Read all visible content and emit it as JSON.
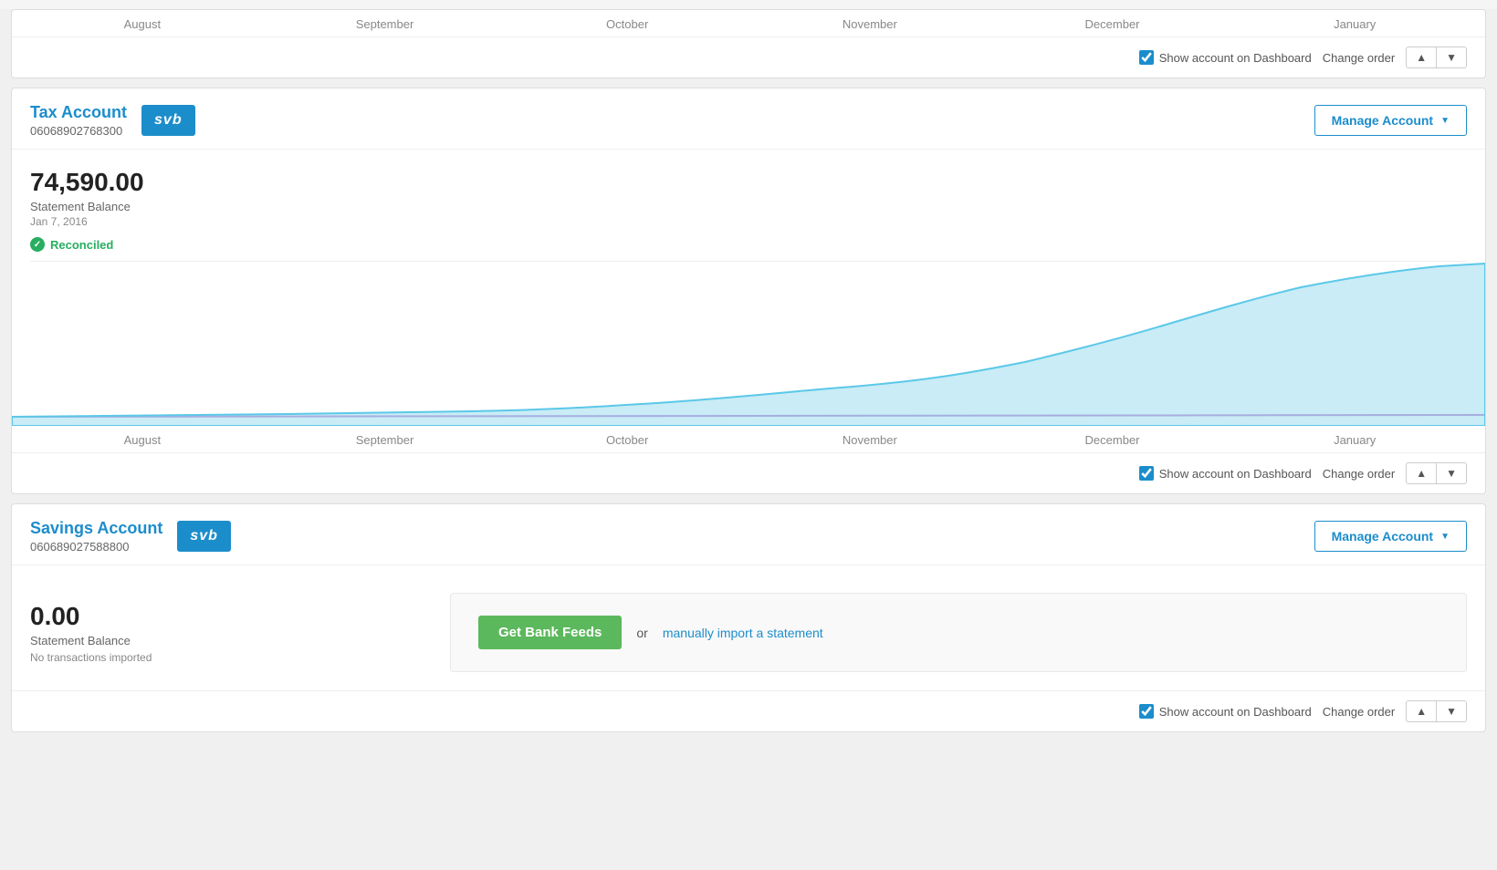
{
  "top_card": {
    "months": [
      "August",
      "September",
      "October",
      "November",
      "December",
      "January"
    ],
    "show_dashboard_label": "Show account on Dashboard",
    "change_order_label": "Change order"
  },
  "tax_account": {
    "name": "Tax Account",
    "number": "06068902768300",
    "logo_text": "svb",
    "manage_btn": "Manage Account",
    "balance": "74,590.00",
    "balance_label": "Statement Balance",
    "balance_date": "Jan 7, 2016",
    "reconciled_label": "Reconciled",
    "months": [
      "August",
      "September",
      "October",
      "November",
      "December",
      "January"
    ],
    "show_dashboard_label": "Show account on Dashboard",
    "change_order_label": "Change order"
  },
  "savings_account": {
    "name": "Savings Account",
    "number": "060689027588800",
    "logo_text": "svb",
    "manage_btn": "Manage Account",
    "balance": "0.00",
    "balance_label": "Statement Balance",
    "no_transactions": "No transactions imported",
    "get_bank_feeds_label": "Get Bank Feeds",
    "or_text": "or",
    "import_link_text": "manually import a statement",
    "show_dashboard_label": "Show account on Dashboard",
    "change_order_label": "Change order"
  }
}
